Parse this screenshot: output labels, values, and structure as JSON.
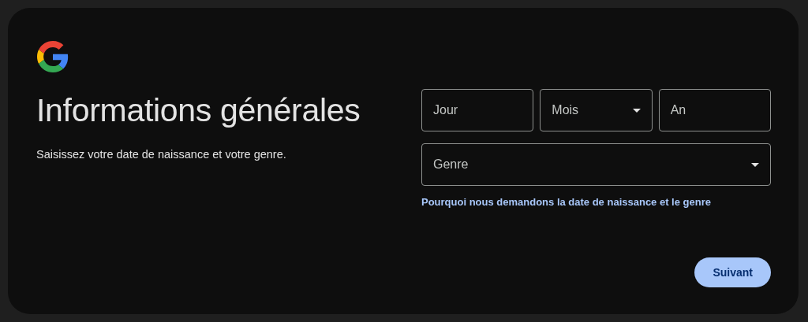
{
  "title": "Informations générales",
  "subtitle": "Saisissez votre date de naissance et votre genre.",
  "date_fields": [
    {
      "kind": "text",
      "placeholder": "Jour"
    },
    {
      "kind": "select",
      "label": "Mois"
    },
    {
      "kind": "text",
      "placeholder": "An"
    }
  ],
  "gender_field": {
    "kind": "select",
    "label": "Genre"
  },
  "help_link": "Pourquoi nous demandons la date de naissance et le genre",
  "buttons": [
    "Suivant"
  ]
}
